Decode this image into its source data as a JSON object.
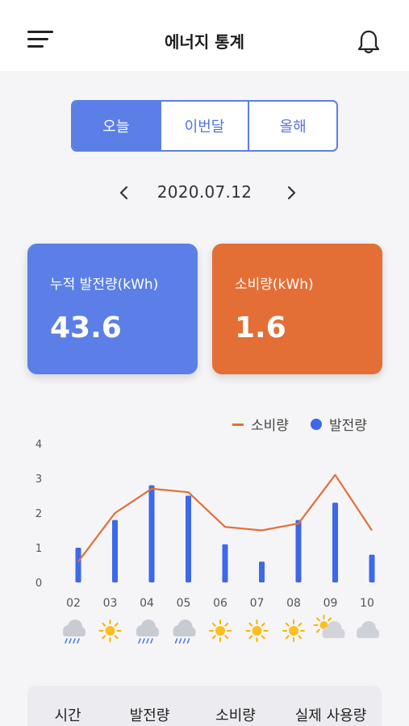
{
  "header": {
    "title": "에너지 통계"
  },
  "tabs": [
    {
      "label": "오늘",
      "active": true
    },
    {
      "label": "이번달",
      "active": false
    },
    {
      "label": "올해",
      "active": false
    }
  ],
  "date": {
    "value": "2020.07.12",
    "prev_icon": "chevron-left-icon",
    "next_icon": "chevron-right-icon"
  },
  "cards": {
    "generation": {
      "label": "누적 발전량(kWh)",
      "value": "43.6",
      "color": "#5b7fe6"
    },
    "consumption": {
      "label": "소비량(kWh)",
      "value": "1.6",
      "color": "#e36f37"
    }
  },
  "chart_data": {
    "type": "bar",
    "categories": [
      "02",
      "03",
      "04",
      "05",
      "06",
      "07",
      "08",
      "09",
      "10"
    ],
    "yticks": [
      "0",
      "1",
      "2",
      "3",
      "4"
    ],
    "ylim": [
      0,
      4
    ],
    "series": [
      {
        "name": "발전량",
        "kind": "bar",
        "color": "#3d68e8",
        "values": [
          1.0,
          1.8,
          2.8,
          2.5,
          1.1,
          0.6,
          1.8,
          2.3,
          0.8
        ]
      },
      {
        "name": "소비량",
        "kind": "line",
        "color": "#e36f37",
        "values": [
          0.6,
          2.0,
          2.7,
          2.6,
          1.6,
          1.5,
          1.7,
          3.1,
          1.5
        ]
      }
    ],
    "weather": [
      "rain",
      "sun",
      "rain",
      "rain",
      "sun",
      "sun",
      "sun",
      "partly-cloudy",
      "cloud"
    ]
  },
  "table": {
    "headers": [
      "시간",
      "발전량",
      "소비량",
      "실제 사용량"
    ]
  }
}
